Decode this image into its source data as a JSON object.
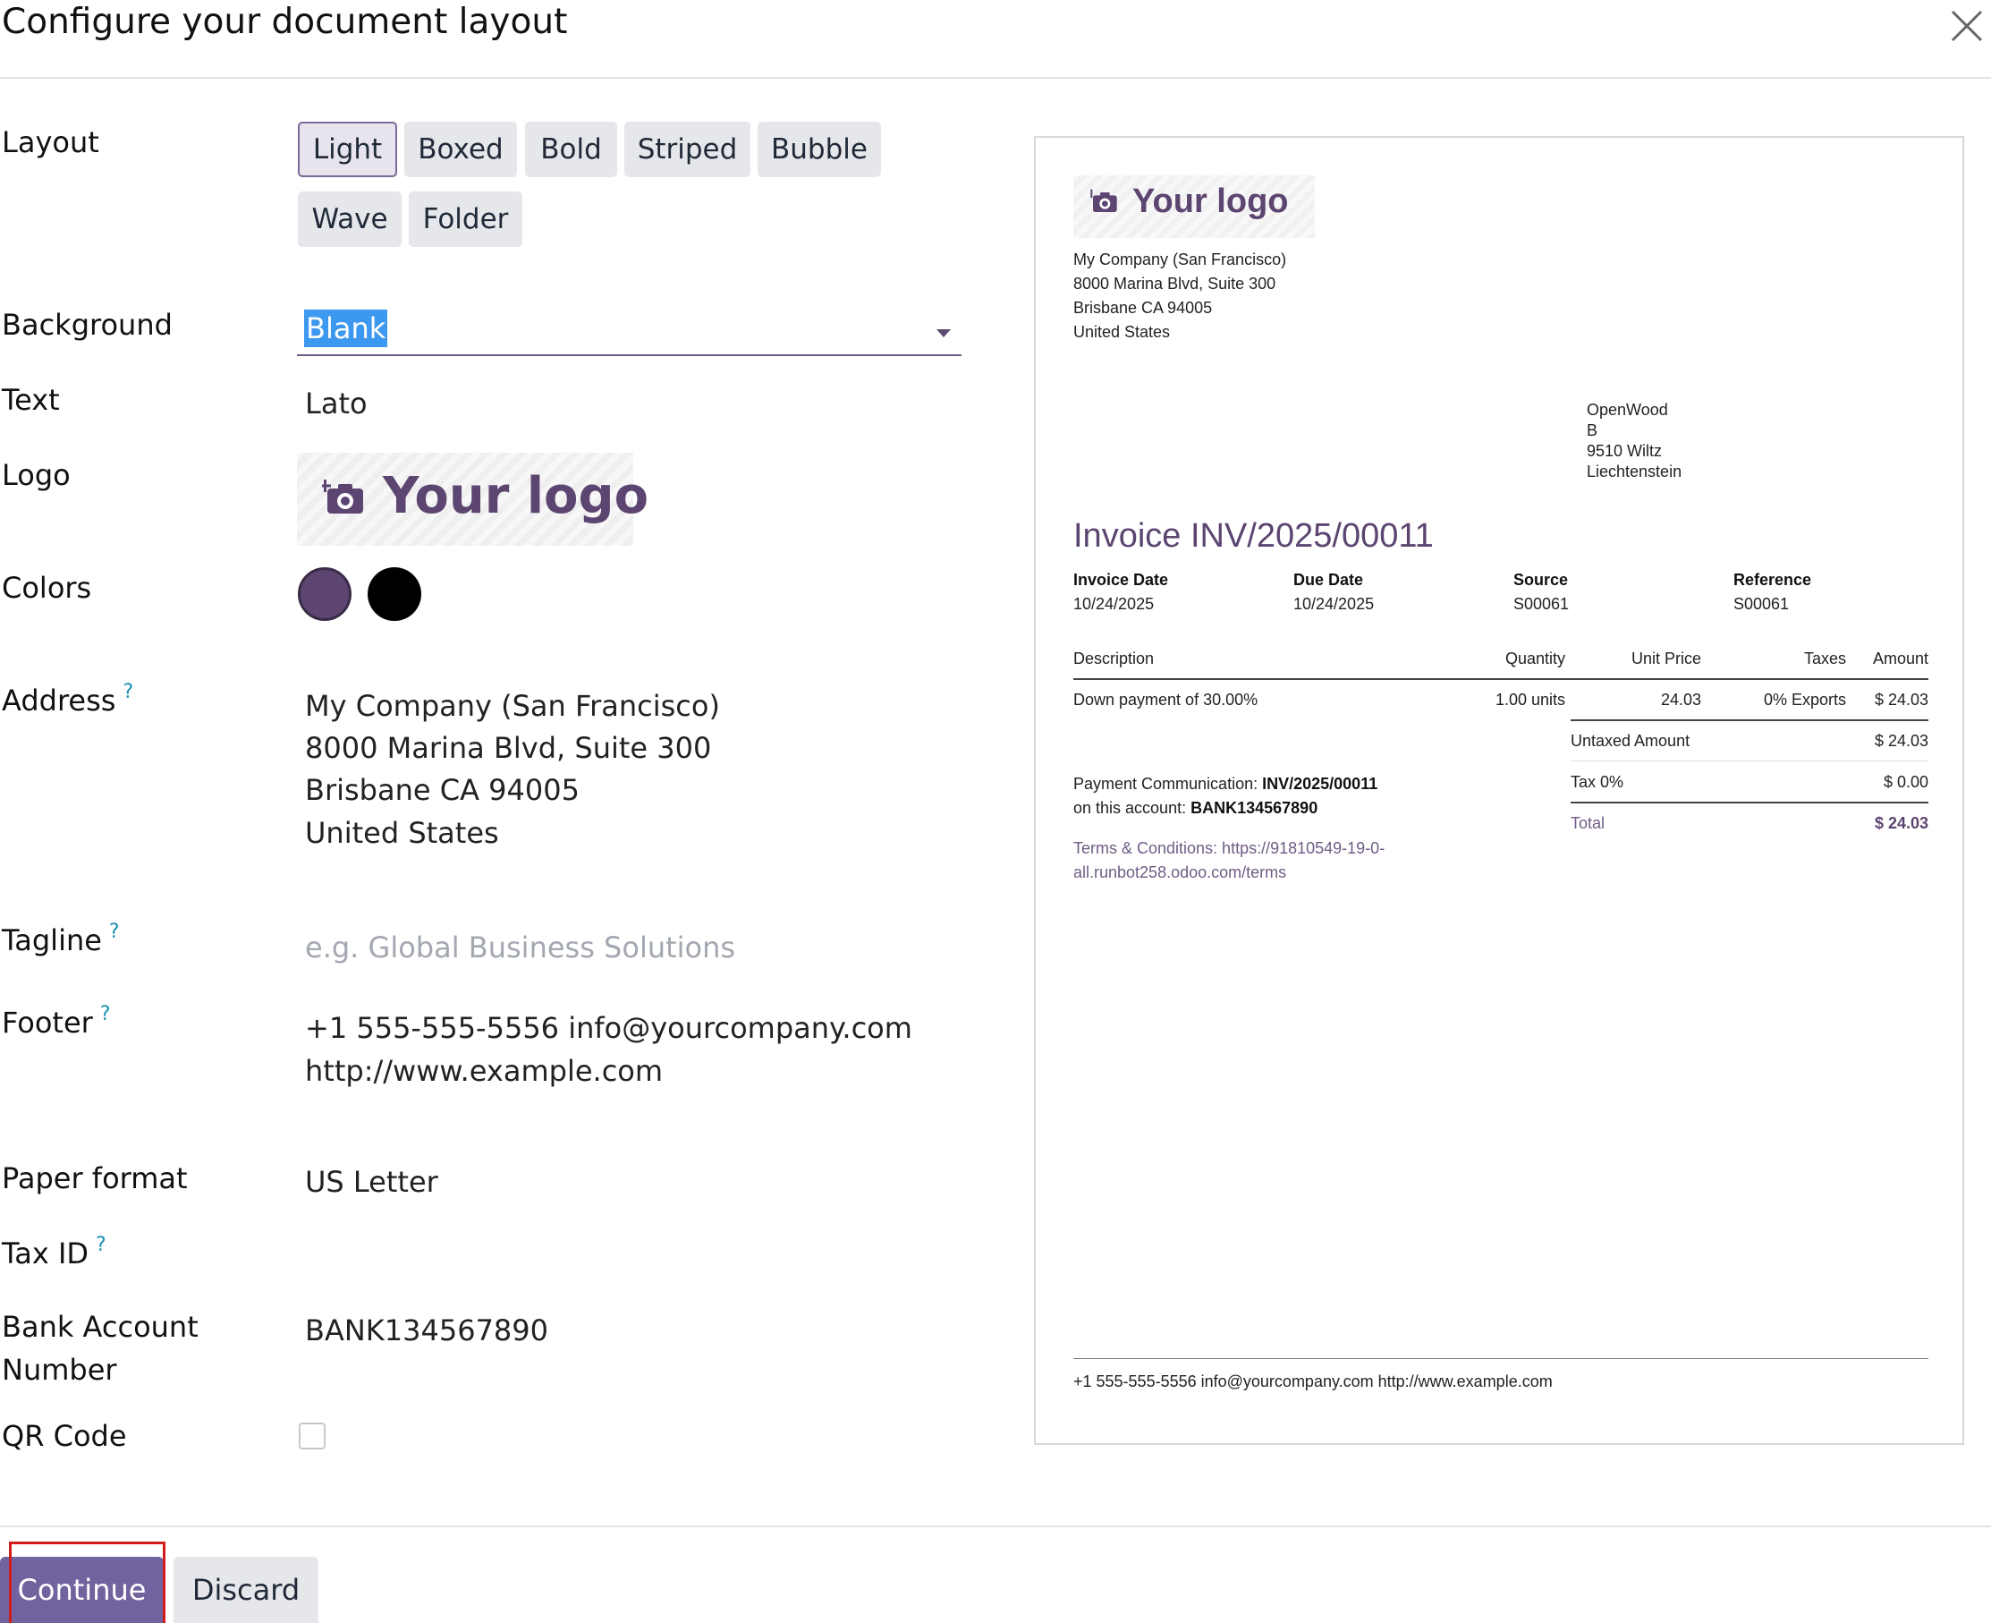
{
  "dialog": {
    "title": "Configure your document layout"
  },
  "labels": {
    "layout": "Layout",
    "background": "Background",
    "text": "Text",
    "logo": "Logo",
    "colors": "Colors",
    "address": "Address",
    "tagline": "Tagline",
    "footer": "Footer",
    "paper_format": "Paper format",
    "tax_id": "Tax ID",
    "bank_account_1": "Bank Account",
    "bank_account_2": "Number",
    "qr_code": "QR Code",
    "help_mark": "?"
  },
  "layout_options": [
    "Light",
    "Boxed",
    "Bold",
    "Striped",
    "Bubble",
    "Wave",
    "Folder"
  ],
  "layout_selected": "Light",
  "background": {
    "value": "Blank"
  },
  "text_font": "Lato",
  "logo": {
    "text": "Your logo",
    "icon": "camera-plus-icon"
  },
  "colors": {
    "primary": "#5c4570",
    "secondary": "#000000"
  },
  "address_lines": [
    "My Company (San Francisco)",
    "8000 Marina Blvd, Suite 300",
    "Brisbane CA 94005",
    "United States"
  ],
  "tagline": {
    "value": "",
    "placeholder": "e.g. Global Business Solutions"
  },
  "footer_lines": [
    "+1 555-555-5556 info@yourcompany.com",
    "http://www.example.com"
  ],
  "paper_format": "US Letter",
  "tax_id": "",
  "bank_account": "BANK134567890",
  "qr_code": {
    "checked": false
  },
  "buttons": {
    "continue": "Continue",
    "discard": "Discard"
  },
  "preview": {
    "logo_text": "Your logo",
    "company_lines": [
      "My Company (San Francisco)",
      "8000 Marina Blvd, Suite 300",
      "Brisbane CA 94005",
      "United States"
    ],
    "customer_lines": [
      "OpenWood",
      "B",
      "9510 Wiltz",
      "Liechtenstein"
    ],
    "invoice_title": "Invoice INV/2025/00011",
    "info": [
      {
        "label": "Invoice Date",
        "value": "10/24/2025"
      },
      {
        "label": "Due Date",
        "value": "10/24/2025"
      },
      {
        "label": "Source",
        "value": "S00061"
      },
      {
        "label": "Reference",
        "value": "S00061"
      }
    ],
    "table_headers": [
      "Description",
      "Quantity",
      "Unit Price",
      "Taxes",
      "Amount"
    ],
    "table_row": [
      "Down payment of 30.00%",
      "1.00 units",
      "24.03",
      "0% Exports",
      "$ 24.03"
    ],
    "totals": {
      "untaxed_label": "Untaxed Amount",
      "untaxed_value": "$ 24.03",
      "tax_label": "Tax 0%",
      "tax_value": "$ 0.00",
      "total_label": "Total",
      "total_value": "$ 24.03"
    },
    "payment_comm_label": "Payment Communication:",
    "payment_comm_value": "INV/2025/00011",
    "account_label": "on this account:",
    "account_value": "BANK134567890",
    "terms_line1": "Terms & Conditions: https://91810549-19-0-",
    "terms_line2": "all.runbot258.odoo.com/terms",
    "footer_text": "+1 555-555-5556 info@yourcompany.com http://www.example.com"
  }
}
